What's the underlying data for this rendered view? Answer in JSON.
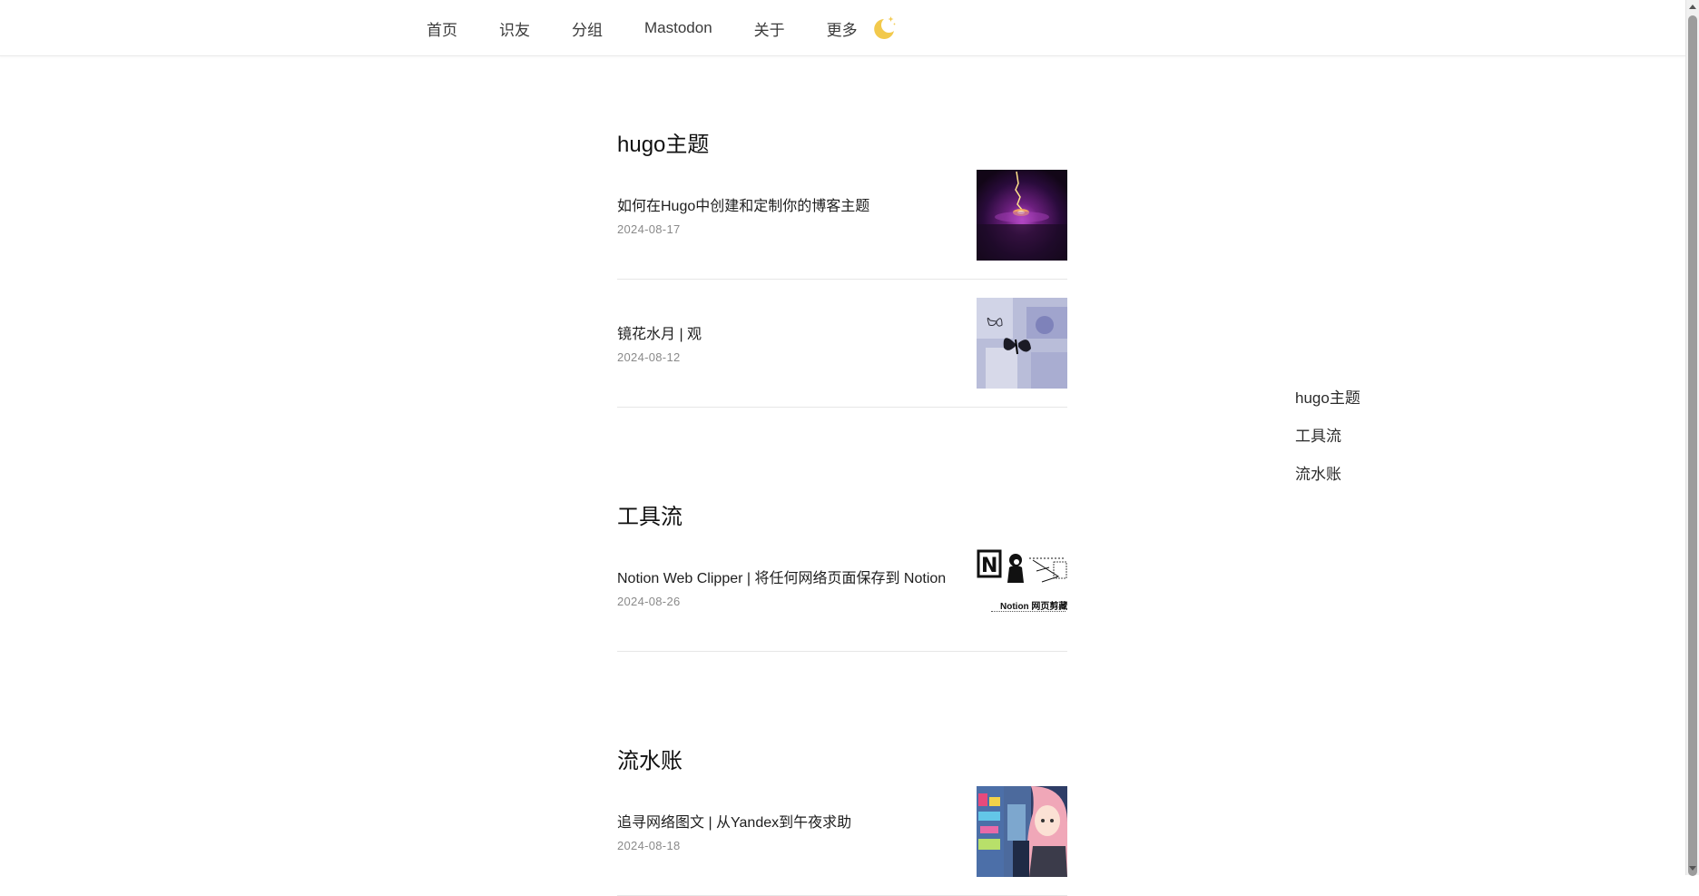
{
  "nav": {
    "items": [
      {
        "label": "首页"
      },
      {
        "label": "识友"
      },
      {
        "label": "分组"
      },
      {
        "label": "Mastodon"
      },
      {
        "label": "关于"
      },
      {
        "label": "更多"
      }
    ],
    "theme_toggle_icon": "moon-icon",
    "moon_color": "#f2c94c"
  },
  "sections": [
    {
      "title": "hugo主题",
      "posts": [
        {
          "title": "如何在Hugo中创建和定制你的博客主题",
          "date": "2024-08-17",
          "thumb": "purple-lightning-image"
        },
        {
          "title": "镜花水月 | 观",
          "date": "2024-08-12",
          "thumb": "butterfly-collage-image"
        }
      ]
    },
    {
      "title": "工具流",
      "posts": [
        {
          "title": "Notion Web Clipper | 将任何网络页面保存到 Notion",
          "date": "2024-08-26",
          "thumb": "notion-clipper-image",
          "thumb_caption": "Notion 网页剪藏"
        }
      ]
    },
    {
      "title": "流水账",
      "posts": [
        {
          "title": "追寻网络图文 | 从Yandex到午夜求助",
          "date": "2024-08-18",
          "thumb": "anime-girl-image"
        }
      ]
    }
  ],
  "toc": {
    "items": [
      {
        "label": "hugo主题"
      },
      {
        "label": "工具流"
      },
      {
        "label": "流水账"
      }
    ]
  }
}
